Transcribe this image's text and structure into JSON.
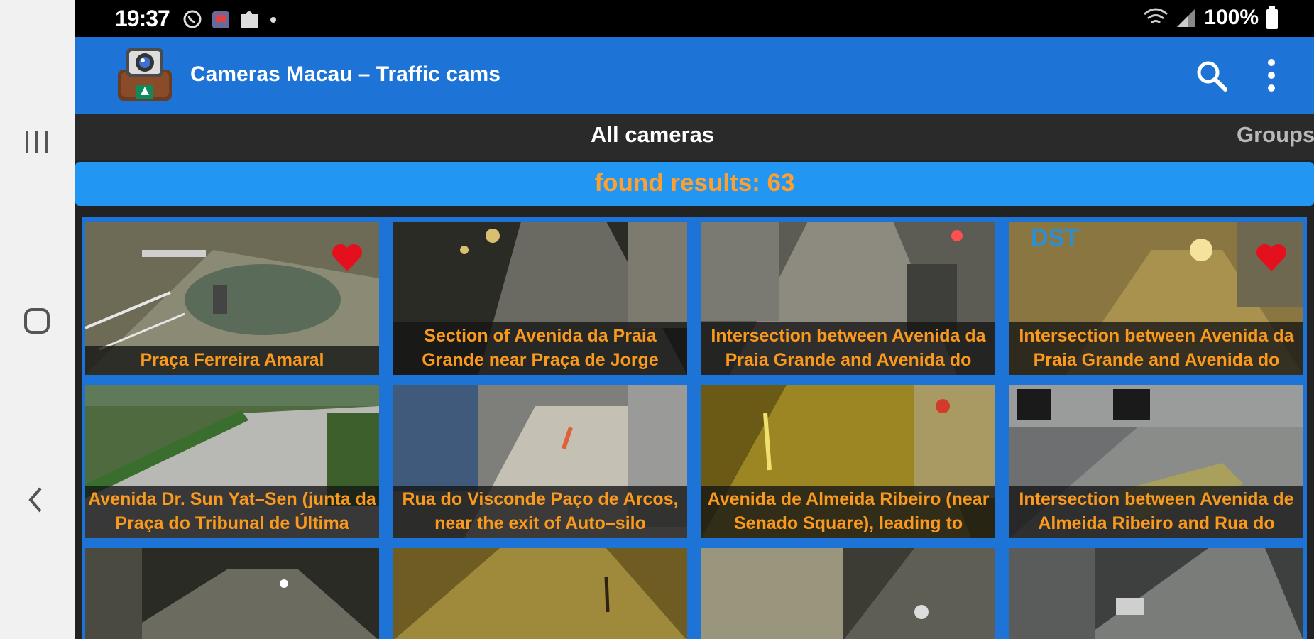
{
  "status_bar": {
    "time": "19:37",
    "battery": "100%"
  },
  "app_bar": {
    "title": "Cameras Macau – Traffic cams",
    "icons": [
      "app-logo-icon",
      "search-icon",
      "more-vert-icon"
    ]
  },
  "tabs": [
    {
      "label": "All cameras",
      "selected": true
    },
    {
      "label": "Groups",
      "selected": false
    }
  ],
  "results": {
    "text": "found results: 63"
  },
  "cameras": [
    {
      "caption": "Praça Ferreira Amaral",
      "favorite": true
    },
    {
      "caption": "Section of Avenida da Praia Grande near Praça de Jorge",
      "favorite": false
    },
    {
      "caption": "Intersection between Avenida da Praia Grande and Avenida do",
      "favorite": false
    },
    {
      "caption": "Intersection between Avenida da Praia Grande and Avenida do",
      "favorite": true
    },
    {
      "caption": "Avenida Dr. Sun Yat–Sen (junta da Praça do Tribunal de Última",
      "favorite": false
    },
    {
      "caption": "Rua do Visconde Paço de Arcos, near the exit of Auto–silo",
      "favorite": false
    },
    {
      "caption": "Avenida de Almeida Ribeiro (near Senado Square), leading to",
      "favorite": false
    },
    {
      "caption": "Intersection between Avenida de Almeida Ribeiro and Rua do",
      "favorite": false
    }
  ],
  "colors": {
    "app_bar": "#1e73d6",
    "results_bar": "#2196f3",
    "accent_text": "#f99a1e",
    "favorite": "#e5101d"
  }
}
